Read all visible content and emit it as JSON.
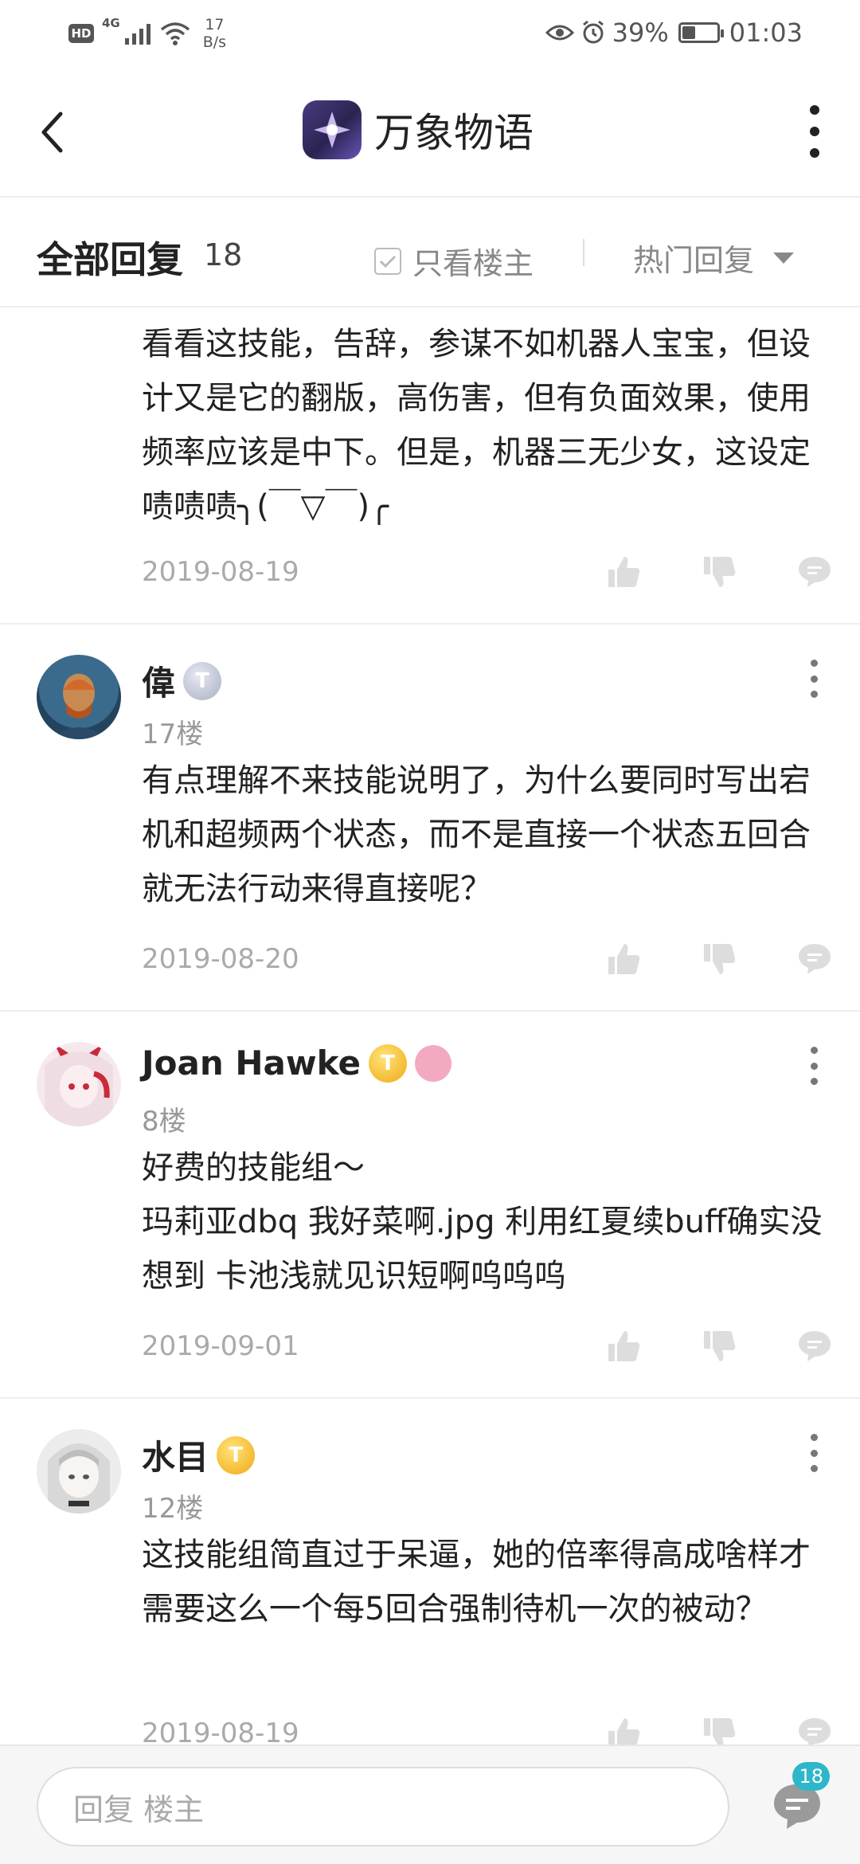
{
  "status_bar": {
    "hd": "HD",
    "network": "4G",
    "speed_value": "17",
    "speed_unit": "B/s",
    "battery": "39%",
    "battery_level": 0.39,
    "time": "01:03",
    "icons": [
      "signal-icon",
      "wifi-icon",
      "eye-icon",
      "alarm-icon",
      "battery-icon"
    ]
  },
  "header": {
    "title": "万象物语",
    "icons": [
      "back-icon",
      "app-logo-icon",
      "more-icon"
    ]
  },
  "filter": {
    "title": "全部回复",
    "count": "18",
    "only_owner_label": "只看楼主",
    "only_owner_checked": false,
    "sort_label": "热门回复"
  },
  "comments": [
    {
      "text": "看看这技能，告辞，参谋不如机器人宝宝，但设计又是它的翻版，高伤害，但有负面效果，使用频率应该是中下。但是，机器三无少女，这设定啧啧啧╮(￣▽￣)╭",
      "date": "2019-08-19"
    },
    {
      "user": "偉",
      "badge": "T",
      "floor": "17楼",
      "text": "有点理解不来技能说明了，为什么要同时写出宕机和超频两个状态，而不是直接一个状态五回合就无法行动来得直接呢？",
      "date": "2019-08-20"
    },
    {
      "user": "Joan Hawke",
      "badge": "T",
      "floor": "8楼",
      "text": "好费的技能组～\n玛莉亚dbq 我好菜啊.jpg 利用红夏续buff确实没想到 卡池浅就见识短啊呜呜呜",
      "date": "2019-09-01"
    },
    {
      "user": "水目",
      "badge": "T",
      "floor": "12楼",
      "text": "这技能组简直过于呆逼，她的倍率得高成啥样才需要这么一个每5回合强制待机一次的被动？",
      "date": "2019-08-19"
    }
  ],
  "bottom": {
    "placeholder": "回复  楼主",
    "reply_count": "18"
  },
  "colors": {
    "accent": "#2db7c9",
    "gold_badge": "#f0a914",
    "silver_badge": "#a9afc3",
    "pink_badge": "#f3a9c0"
  }
}
